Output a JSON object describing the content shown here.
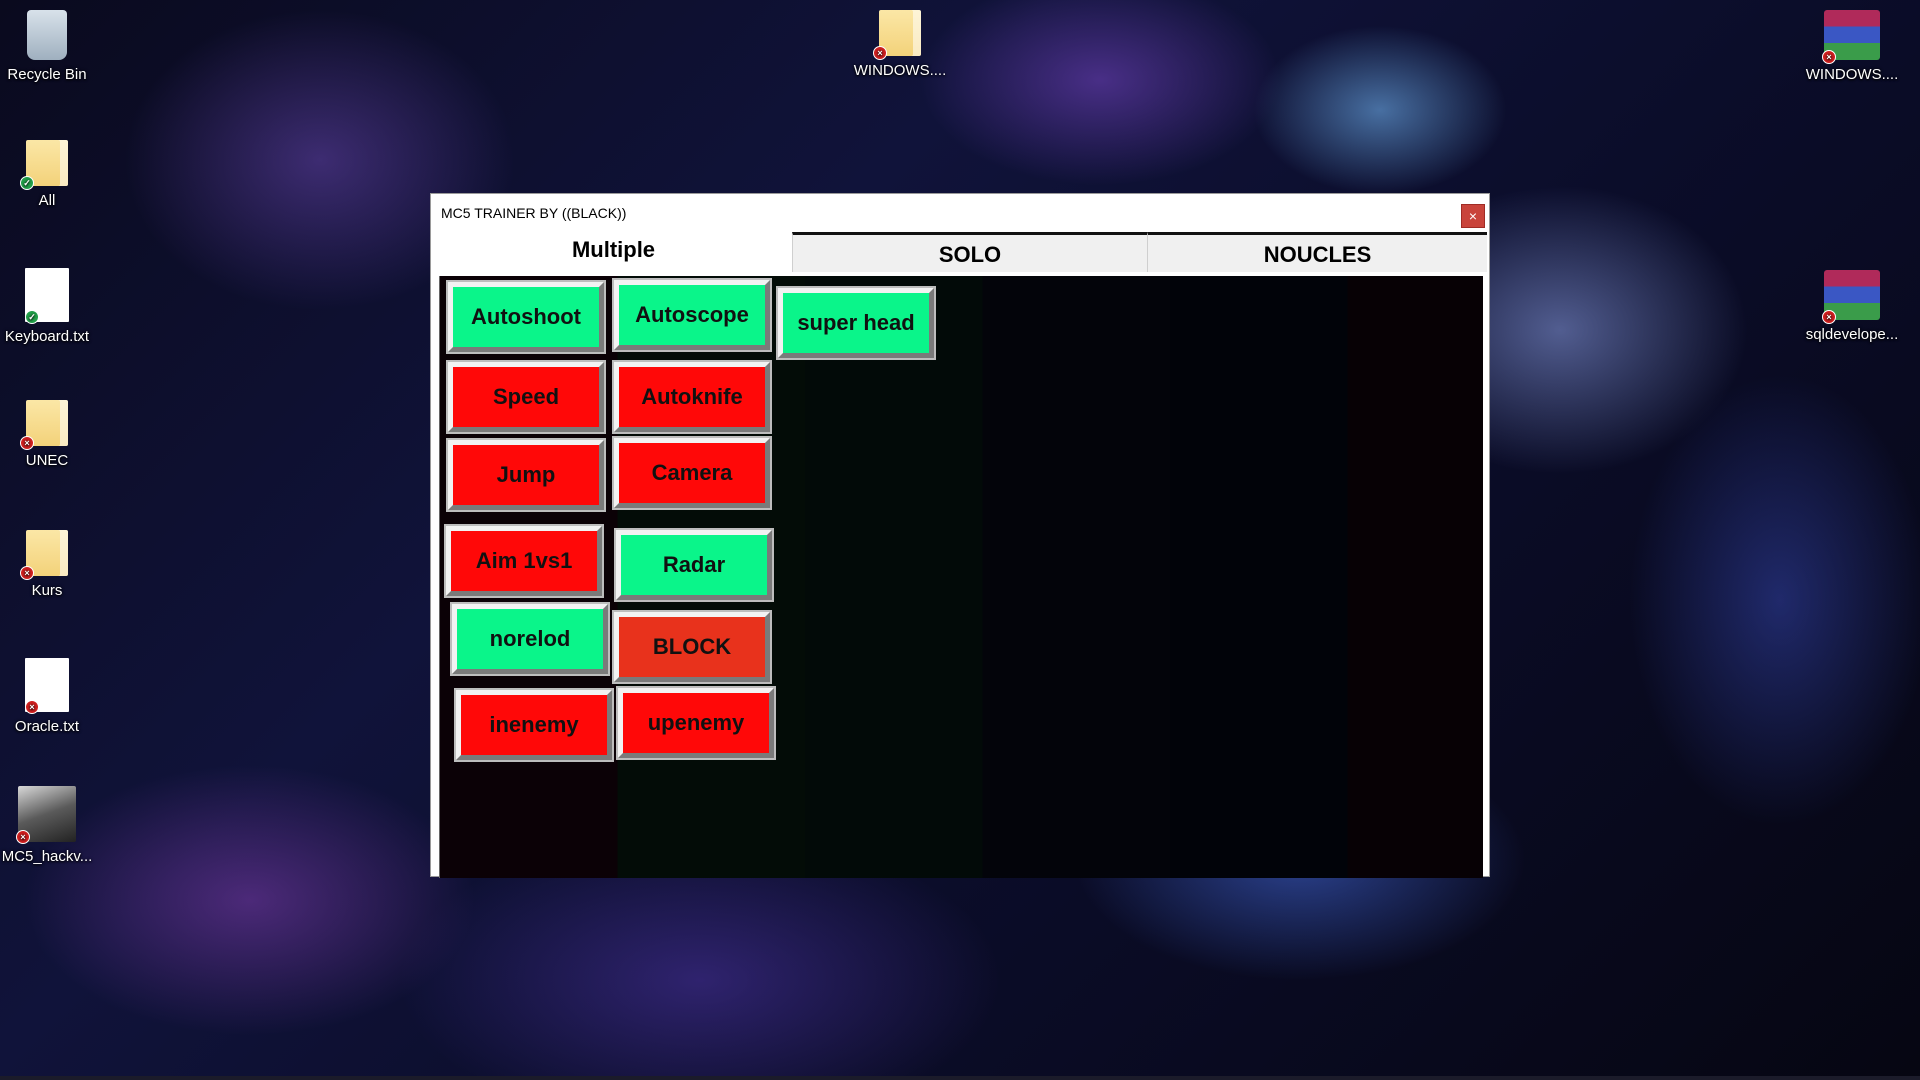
{
  "desktop": {
    "icons": [
      {
        "label": "Recycle Bin",
        "type": "bin",
        "badge": ""
      },
      {
        "label": "All",
        "type": "folder",
        "badge": "ok"
      },
      {
        "label": "Keyboard.txt",
        "type": "doc",
        "badge": "ok"
      },
      {
        "label": "UNEC",
        "type": "folder",
        "badge": "err"
      },
      {
        "label": "Kurs",
        "type": "folder",
        "badge": "err"
      },
      {
        "label": "Oracle.txt",
        "type": "doc",
        "badge": "err"
      },
      {
        "label": "MC5_hackv...",
        "type": "exe",
        "badge": "err"
      },
      {
        "label": "WINDOWS....",
        "type": "folder-zip",
        "badge": "err"
      },
      {
        "label": "WINDOWS....",
        "type": "rar",
        "badge": "err"
      },
      {
        "label": "sqldevelope...",
        "type": "rar",
        "badge": "err"
      }
    ]
  },
  "window": {
    "title": "MC5 TRAINER BY  ((BLACK))",
    "close_label": "×",
    "tabs": [
      {
        "label": "Multiple",
        "active": true
      },
      {
        "label": "SOLO",
        "active": false
      },
      {
        "label": "NOUCLES",
        "active": false
      }
    ],
    "buttons": [
      {
        "label": "Autoshoot",
        "state": "on"
      },
      {
        "label": "Autoscope",
        "state": "on"
      },
      {
        "label": "super head",
        "state": "on"
      },
      {
        "label": "Speed",
        "state": "off"
      },
      {
        "label": "Autoknife",
        "state": "off"
      },
      {
        "label": "Jump",
        "state": "off"
      },
      {
        "label": "Camera",
        "state": "off"
      },
      {
        "label": "Aim 1vs1",
        "state": "off"
      },
      {
        "label": "Radar",
        "state": "on"
      },
      {
        "label": "norelod",
        "state": "on"
      },
      {
        "label": "BLOCK",
        "state": "block"
      },
      {
        "label": "inenemy",
        "state": "off"
      },
      {
        "label": "upenemy",
        "state": "off"
      }
    ]
  },
  "colors": {
    "on": "#0af58a",
    "off": "#ff0808",
    "block": "#e8321c",
    "close": "#c9443b"
  }
}
